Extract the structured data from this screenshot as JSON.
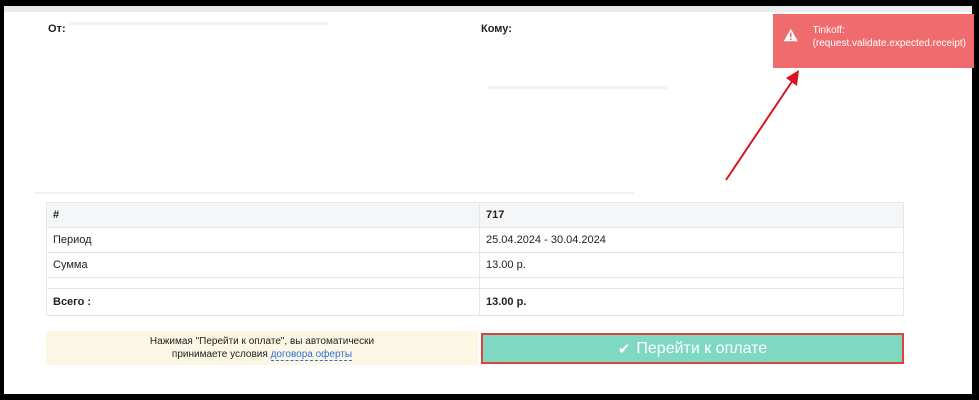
{
  "invoice": {
    "from_label": "От:",
    "to_label": "Кому:"
  },
  "table": {
    "header": {
      "label": "#",
      "value": "717"
    },
    "rows": [
      {
        "label": "Период",
        "value": "25.04.2024 - 30.04.2024"
      },
      {
        "label": "Сумма",
        "value": "13.00 р."
      }
    ],
    "total": {
      "label": "Всего :",
      "value": "13.00 р."
    }
  },
  "notice": {
    "line1": "Нажимая \"Перейти к оплате\", вы автоматически",
    "line2_prefix": "принимаете условия ",
    "link_text": "договора оферты"
  },
  "pay_button": {
    "label": "Перейти к оплате",
    "icon": "check-icon"
  },
  "toast": {
    "title": "Tinkoff:",
    "message": "(request.validate.expected.receipt)",
    "icon": "warning-icon"
  },
  "colors": {
    "pay_button_bg": "#7fd8c2",
    "highlight_border": "#e0433b",
    "toast_bg": "#ef6b6e",
    "notice_bg": "#fcf7e4",
    "link": "#2a6fdb"
  }
}
